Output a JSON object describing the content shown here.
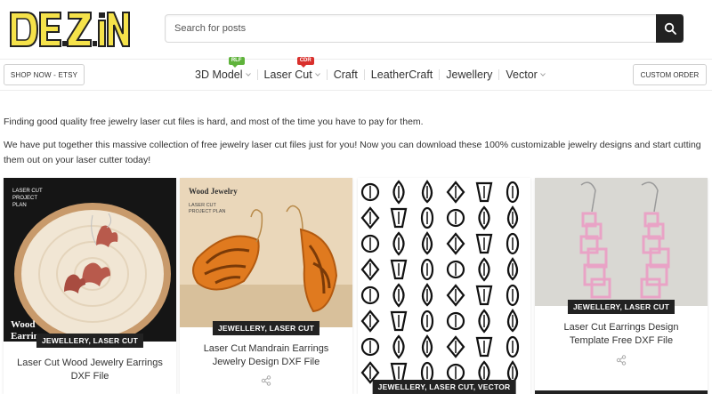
{
  "header": {
    "logo_text": "DEZiN",
    "search_placeholder": "Search for posts"
  },
  "nav": {
    "shop_label": "SHOP NOW - ETSY",
    "custom_label": "CUSTOM ORDER",
    "items": [
      {
        "label": "3D Model",
        "badge": "RLF",
        "badge_color": "#5fb33b",
        "dropdown": true
      },
      {
        "label": "Laser Cut",
        "badge": "CDR",
        "badge_color": "#d9302c",
        "dropdown": true
      },
      {
        "label": "Craft"
      },
      {
        "label": "LeatherCraft"
      },
      {
        "label": "Jewellery"
      },
      {
        "label": "Vector",
        "dropdown": true
      }
    ]
  },
  "intro": {
    "p1": "Finding good quality free jewelry laser cut files is hard, and most of the time you have to pay for them.",
    "p2": "We have put together this massive collection of free jewelry laser cut files just for you! Now you can download these 100% customizable jewelry designs and start cutting them out on your laser cutter today!"
  },
  "cards": [
    {
      "tag": "JEWELLERY, LASER CUT",
      "title": "Laser Cut Wood Jewelry Earrings DXF File",
      "img_label_top": "LASER CUT PROJECT PLAN",
      "img_label_bottom": "Wood Earrings"
    },
    {
      "tag": "JEWELLERY, LASER CUT",
      "title": "Laser Cut Mandrain Earrings Jewelry Design DXF File",
      "img_label_top": "Wood Jewelry",
      "img_label_sub": "LASER CUT PROJECT PLAN"
    },
    {
      "tag": "JEWELLERY, LASER CUT, VECTOR",
      "title": ""
    },
    {
      "tag": "JEWELLERY, LASER CUT",
      "title": "Laser Cut Earrings Design Template Free DXF File"
    }
  ],
  "icons": {
    "search": "search-icon",
    "share": "share-icon",
    "chevron": "chevron-down-icon"
  },
  "colors": {
    "logo_yellow": "#f5e24a",
    "dark": "#222222",
    "wood": "#e2882f",
    "pink": "#e9a3c6"
  }
}
